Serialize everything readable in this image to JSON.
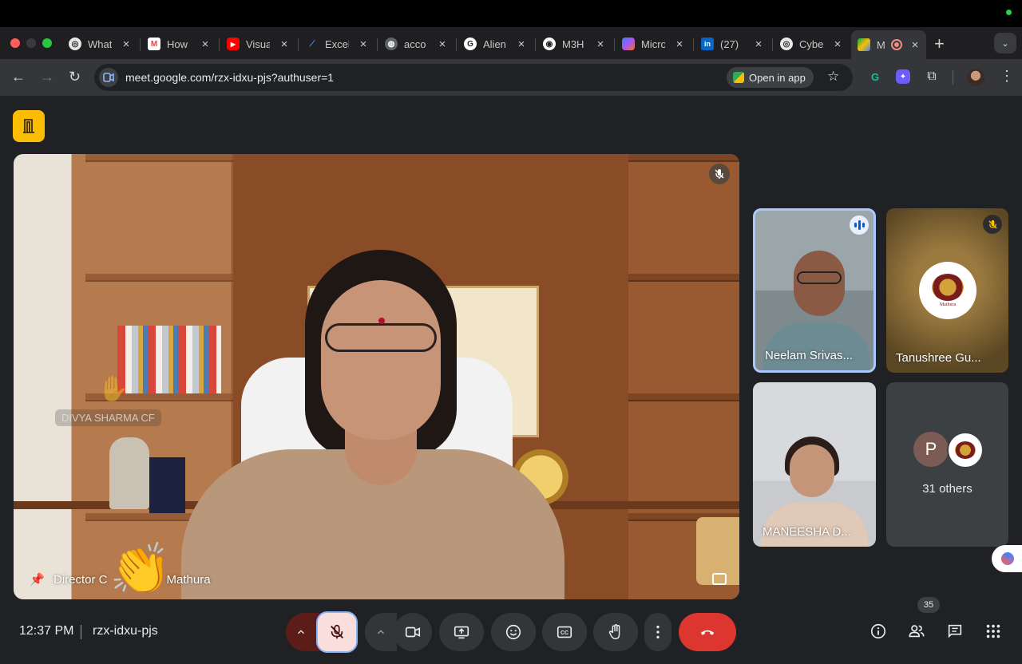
{
  "browser": {
    "tabs": [
      {
        "title": "What",
        "icon": "chatgpt-icon",
        "color": "#444"
      },
      {
        "title": "How",
        "icon": "gmail-icon",
        "color": "#ea4335"
      },
      {
        "title": "Visua",
        "icon": "youtube-icon",
        "color": "#ff0000"
      },
      {
        "title": "Excel",
        "icon": "chart-icon",
        "color": "#1a73e8"
      },
      {
        "title": "acco",
        "icon": "globe-icon",
        "color": "#555"
      },
      {
        "title": "Alien",
        "icon": "grammarly-icon",
        "color": "#222"
      },
      {
        "title": "M3H",
        "icon": "podcast-icon",
        "color": "#222"
      },
      {
        "title": "Micro",
        "icon": "copilot-icon",
        "color": "#7b61ff"
      },
      {
        "title": "(27)",
        "icon": "linkedin-icon",
        "color": "#0a66c2"
      },
      {
        "title": "Cybe",
        "icon": "chatgpt-icon",
        "color": "#444"
      },
      {
        "title": "M",
        "icon": "meet-icon",
        "color": "#00832d"
      }
    ],
    "url": "meet.google.com/rzx-idxu-pjs?authuser=1",
    "open_in_app": "Open in app"
  },
  "meeting": {
    "main_speaker_name": "Director C",
    "main_speaker_name_tail": "Mathura",
    "ghost_name": "DIVYA SHARMA CF",
    "reaction": "👏",
    "participants": [
      {
        "name": "Neelam Srivas...",
        "speaking": true
      },
      {
        "name": "Tanushree Gu...",
        "muted": true,
        "logo_text": "Mathura"
      },
      {
        "name": "MANEESHA D..."
      },
      {
        "others": "31 others",
        "initial": "P"
      }
    ]
  },
  "bottom_bar": {
    "time": "12:37 PM",
    "meeting_code": "rzx-idxu-pjs",
    "people_count": "35"
  },
  "colors": {
    "leave": "#dc362e",
    "mic_off_bg": "#f9dedc",
    "accent_blue": "#8ab4f8",
    "door_yellow": "#fbbc04"
  }
}
